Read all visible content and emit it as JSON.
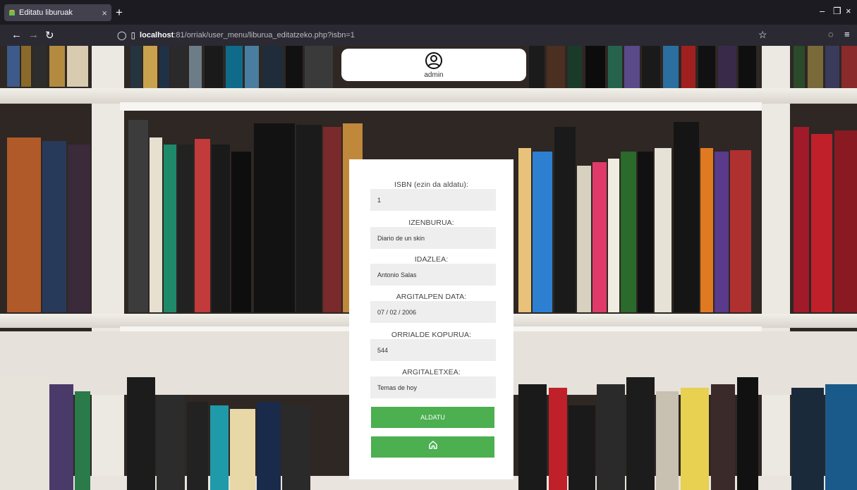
{
  "browser": {
    "tab_title": "Editatu liburuak",
    "tab_close": "×",
    "new_tab": "+",
    "url_host": "localhost",
    "url_rest": ":81/orriak/user_menu/liburua_editatzeko.php?isbn=1",
    "window_controls": {
      "minimize": "–",
      "maximize": "❐",
      "close": "×"
    }
  },
  "user": {
    "name": "admin",
    "icon": "user-circle-icon"
  },
  "form": {
    "fields": [
      {
        "label": "ISBN (ezin da aldatu):",
        "value": "1"
      },
      {
        "label": "IZENBURUA:",
        "value": "Diario de un skin"
      },
      {
        "label": "IDAZLEA:",
        "value": "Antonio Salas"
      },
      {
        "label": "ARGITALPEN DATA:",
        "value": "07 / 02 / 2006"
      },
      {
        "label": "ORRIALDE KOPURUA:",
        "value": "544"
      },
      {
        "label": "ARGITALETXEA:",
        "value": "Temas de hoy"
      }
    ],
    "submit_label": "ALDATU",
    "home_icon": "home-icon"
  },
  "colors": {
    "accent_button": "#4caf50",
    "input_background": "#eeeeee",
    "browser_dark": "#1c1b22"
  }
}
